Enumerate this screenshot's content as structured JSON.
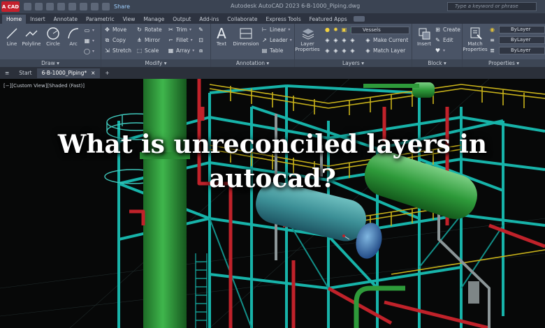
{
  "titlebar": {
    "logo": "A CAD",
    "share": "Share",
    "app_title": "Autodesk AutoCAD 2023   6-B-1000_Piping.dwg",
    "search_placeholder": "Type a keyword or phrase"
  },
  "ribbon_tabs": [
    "Home",
    "Insert",
    "Annotate",
    "Parametric",
    "View",
    "Manage",
    "Output",
    "Add-ins",
    "Collaborate",
    "Express Tools",
    "Featured Apps"
  ],
  "draw": {
    "label": "Draw",
    "tools": [
      "Line",
      "Polyline",
      "Circle",
      "Arc"
    ]
  },
  "modify": {
    "label": "Modify",
    "rows": [
      [
        "Move",
        "Rotate",
        "Trim"
      ],
      [
        "Copy",
        "Mirror",
        "Fillet"
      ],
      [
        "Stretch",
        "Scale",
        "Array"
      ]
    ]
  },
  "annotation": {
    "label": "Annotation",
    "text": "Text",
    "dimension": "Dimension",
    "linear": "Linear",
    "leader": "Leader",
    "table": "Table"
  },
  "layers": {
    "label": "Layers",
    "layer_properties": "Layer Properties",
    "current_layer": "Vessels",
    "make_current": "Make Current",
    "match_layer": "Match Layer"
  },
  "block": {
    "label": "Block",
    "insert": "Insert",
    "create": "Create",
    "edit": "Edit"
  },
  "properties": {
    "label": "Properties",
    "match_properties": "Match Properties",
    "color": "ByLayer",
    "linetype": "ByLayer",
    "lineweight": "ByLayer"
  },
  "doc_tabs": {
    "start": "Start",
    "active": "6-B-1000_Piping*",
    "close": "×",
    "add": "+"
  },
  "viewport": {
    "label": "[−][Custom View][Shaded (Fast)]"
  },
  "headline": {
    "line1": "What is unreconciled layers in",
    "line2": "autocad?"
  },
  "colors": {
    "pipe_green": "#2e9a3a",
    "pipe_red": "#c0222a",
    "structure_cyan": "#17b3a9",
    "railing_yellow": "#c8b21a",
    "vessel_teal": "#4fa7a5",
    "ribbon_bg": "#4a5466"
  }
}
